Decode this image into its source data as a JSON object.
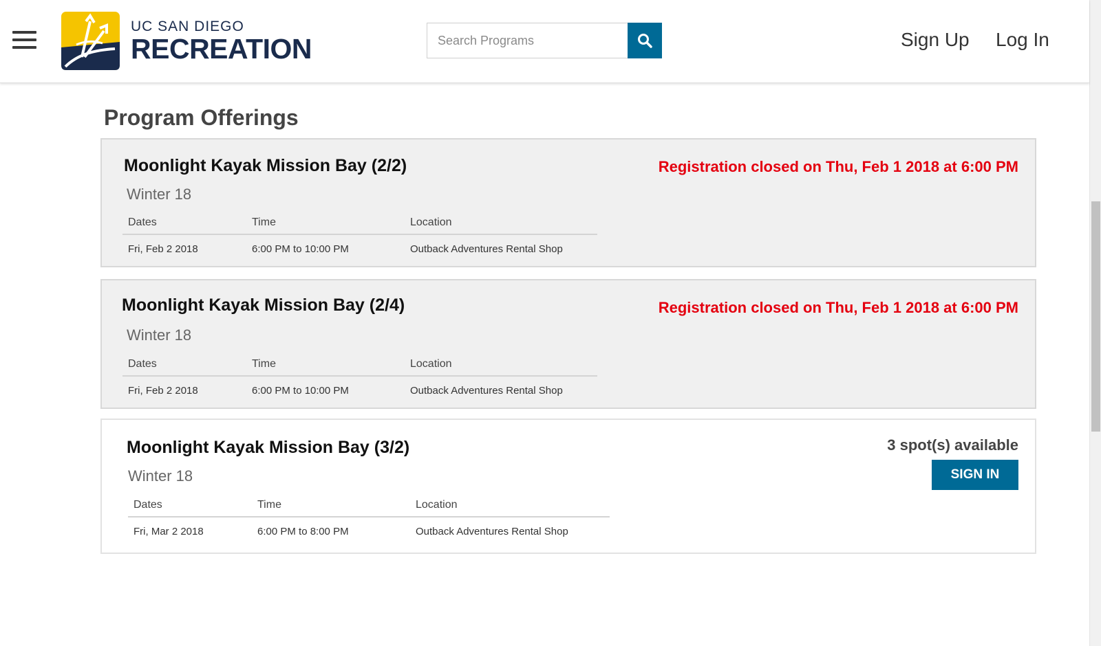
{
  "header": {
    "logo_line1": "UC SAN DIEGO",
    "logo_line2": "RECREATION",
    "search_placeholder": "Search Programs",
    "nav": {
      "sign_up": "Sign Up",
      "log_in": "Log In"
    },
    "colors": {
      "brand_blue": "#006a96",
      "logo_yellow": "#f5c400",
      "logo_navy": "#1a2b4c"
    }
  },
  "main": {
    "title": "Program Offerings",
    "columns": {
      "dates": "Dates",
      "time": "Time",
      "location": "Location"
    },
    "offerings": [
      {
        "title": "Moonlight Kayak Mission Bay (2/2)",
        "term": "Winter 18",
        "status": "Registration closed on Thu, Feb 1 2018 at 6:00 PM",
        "date": "Fri, Feb 2 2018",
        "time": "6:00 PM to 10:00 PM",
        "location": "Outback Adventures Rental Shop"
      },
      {
        "title": "Moonlight Kayak Mission Bay (2/4)",
        "term": "Winter 18",
        "status": "Registration closed on Thu, Feb 1 2018 at 6:00 PM",
        "date": "Fri, Feb 2 2018",
        "time": "6:00 PM to 10:00 PM",
        "location": "Outback Adventures Rental Shop"
      },
      {
        "title": "Moonlight Kayak Mission Bay (3/2)",
        "term": "Winter 18",
        "availability": "3 spot(s) available",
        "button": "SIGN IN",
        "date": "Fri, Mar 2 2018",
        "time": "6:00 PM to 8:00 PM",
        "location": "Outback Adventures Rental Shop"
      }
    ],
    "status_color": "#e4000f"
  }
}
